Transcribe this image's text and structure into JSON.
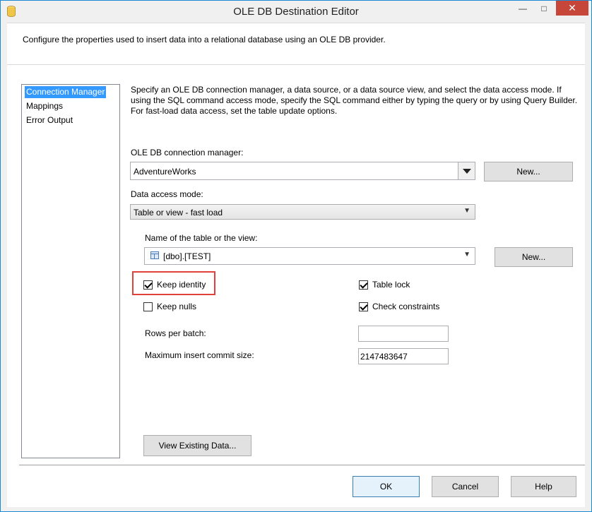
{
  "window": {
    "title": "OLE DB Destination Editor"
  },
  "titlebar": {
    "minimize": "—",
    "maximize": "□",
    "close": "✕"
  },
  "header": {
    "description": "Configure the properties used to insert data into a relational database using an OLE DB provider."
  },
  "nav": {
    "items": [
      {
        "label": "Connection Manager",
        "selected": true
      },
      {
        "label": "Mappings",
        "selected": false
      },
      {
        "label": "Error Output",
        "selected": false
      }
    ]
  },
  "main": {
    "description": "Specify an OLE DB connection manager, a data source, or a data source view, and select the data access mode. If using the SQL command access mode, specify the SQL command either by typing the query or by using Query Builder. For fast-load data access, set the table update options.",
    "connection_manager": {
      "label": "OLE DB connection manager:",
      "value": "AdventureWorks",
      "new_button": "New..."
    },
    "data_access_mode": {
      "label": "Data access mode:",
      "value": "Table or view - fast load"
    },
    "table_view": {
      "label": "Name of the table or the view:",
      "value": "[dbo].[TEST]",
      "new_button": "New..."
    },
    "options": {
      "keep_identity": {
        "label": "Keep identity",
        "checked": true
      },
      "keep_nulls": {
        "label": "Keep nulls",
        "checked": false
      },
      "table_lock": {
        "label": "Table lock",
        "checked": true
      },
      "check_constraints": {
        "label": "Check constraints",
        "checked": true
      }
    },
    "rows_per_batch": {
      "label": "Rows per batch:",
      "value": ""
    },
    "max_commit_size": {
      "label": "Maximum insert commit size:",
      "value": "2147483647"
    },
    "view_existing_button": "View Existing Data..."
  },
  "footer": {
    "ok": "OK",
    "cancel": "Cancel",
    "help": "Help"
  },
  "colors": {
    "accent": "#3399ff",
    "highlight_border": "#e0413a",
    "close_button": "#c7463a"
  }
}
